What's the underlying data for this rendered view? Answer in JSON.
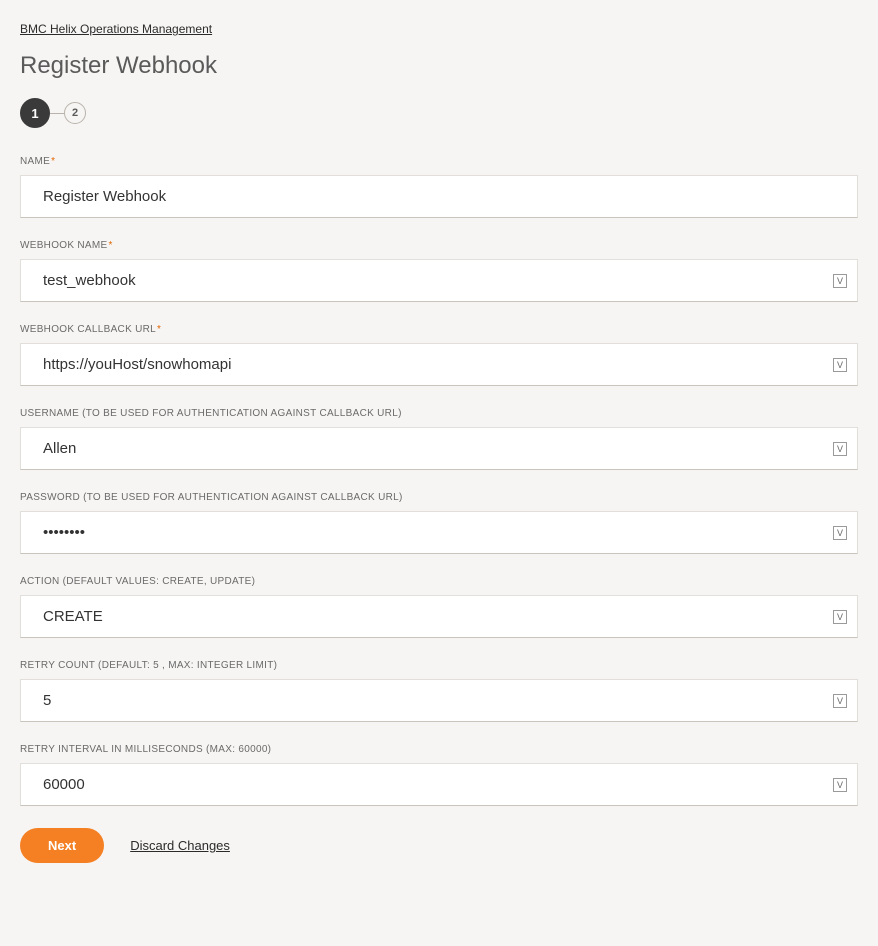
{
  "breadcrumb": "BMC Helix Operations Management",
  "page_title": "Register Webhook",
  "stepper": {
    "steps": [
      "1",
      "2"
    ],
    "active": 0
  },
  "fields": {
    "name": {
      "label": "NAME",
      "value": "Register Webhook",
      "required": true,
      "hasV": false
    },
    "webhook_name": {
      "label": "WEBHOOK NAME",
      "value": "test_webhook",
      "required": true,
      "hasV": true
    },
    "callback_url": {
      "label": "WEBHOOK CALLBACK URL",
      "value": "https://youHost/snowhomapi",
      "required": true,
      "hasV": true
    },
    "username": {
      "label": "USERNAME (TO BE USED FOR AUTHENTICATION AGAINST CALLBACK URL)",
      "value": "Allen",
      "required": false,
      "hasV": true
    },
    "password": {
      "label": "PASSWORD (TO BE USED FOR AUTHENTICATION AGAINST CALLBACK URL)",
      "value": "••••••••",
      "required": false,
      "hasV": true
    },
    "action": {
      "label": "ACTION (DEFAULT VALUES: CREATE, UPDATE)",
      "value": "CREATE",
      "required": false,
      "hasV": true
    },
    "retry_count": {
      "label": "RETRY COUNT (DEFAULT: 5 , MAX: INTEGER LIMIT)",
      "value": "5",
      "required": false,
      "hasV": true
    },
    "retry_interval": {
      "label": "RETRY INTERVAL IN MILLISECONDS (MAX: 60000)",
      "value": "60000",
      "required": false,
      "hasV": true
    }
  },
  "actions": {
    "next": "Next",
    "discard": "Discard Changes"
  }
}
